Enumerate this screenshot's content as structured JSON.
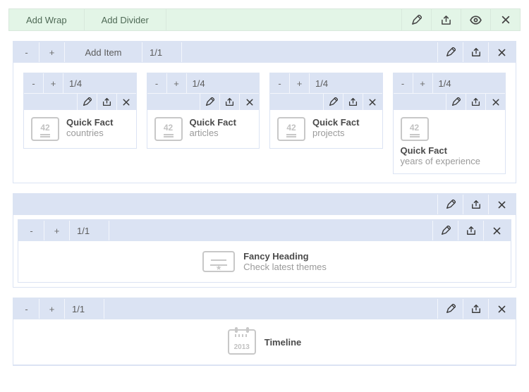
{
  "topbar": {
    "add_wrap": "Add Wrap",
    "add_divider": "Add Divider"
  },
  "s1": {
    "minus": "-",
    "plus": "+",
    "add_item": "Add Item",
    "size": "1/1",
    "cols": [
      {
        "size": "1/4",
        "title": "Quick Fact",
        "sub": "countries",
        "num": "42"
      },
      {
        "size": "1/4",
        "title": "Quick Fact",
        "sub": "articles",
        "num": "42"
      },
      {
        "size": "1/4",
        "title": "Quick Fact",
        "sub": "projects",
        "num": "42"
      },
      {
        "size": "1/4",
        "title": "Quick Fact",
        "sub": "years of experience",
        "num": "42"
      }
    ]
  },
  "s2": {
    "minus": "-",
    "plus": "+",
    "size": "1/1",
    "title": "Fancy Heading",
    "sub": "Check latest themes"
  },
  "s3": {
    "minus": "-",
    "plus": "+",
    "size": "1/1",
    "title": "Timeline",
    "year": "2013"
  }
}
